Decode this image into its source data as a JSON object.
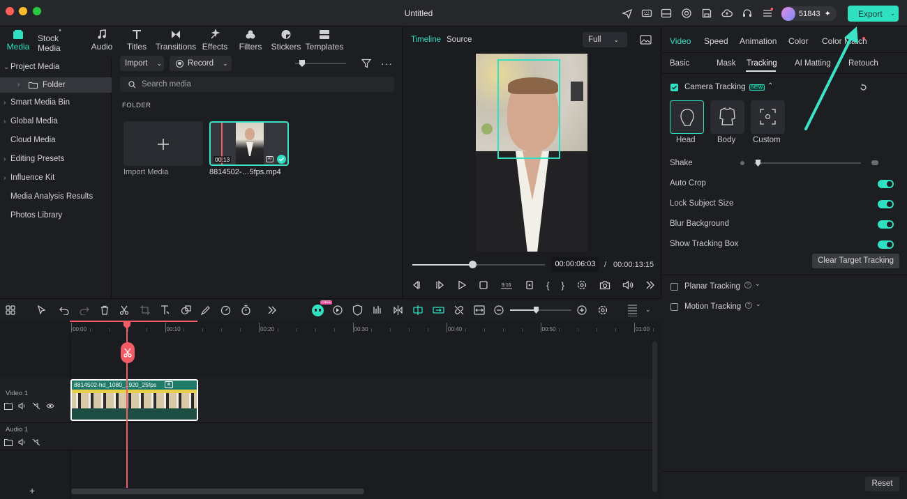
{
  "window": {
    "title": "Untitled",
    "credits": "51843",
    "export_label": "Export"
  },
  "library_tabs": [
    {
      "label": "Media",
      "icon": "media-icon",
      "active": true
    },
    {
      "label": "Stock Media",
      "icon": "stock-media-icon"
    },
    {
      "label": "Audio",
      "icon": "audio-icon"
    },
    {
      "label": "Titles",
      "icon": "titles-icon"
    },
    {
      "label": "Transitions",
      "icon": "transitions-icon"
    },
    {
      "label": "Effects",
      "icon": "effects-icon"
    },
    {
      "label": "Filters",
      "icon": "filters-icon"
    },
    {
      "label": "Stickers",
      "icon": "stickers-icon"
    },
    {
      "label": "Templates",
      "icon": "templates-icon"
    }
  ],
  "sidebar": {
    "items": [
      {
        "label": "Project Media",
        "chevron": "v"
      },
      {
        "label": "Folder",
        "chevron": ">",
        "selected": true
      },
      {
        "label": "Smart Media Bin",
        "chevron": ">"
      },
      {
        "label": "Global Media",
        "chevron": ">"
      },
      {
        "label": "Cloud Media",
        "chevron": ""
      },
      {
        "label": "Editing Presets",
        "chevron": ">"
      },
      {
        "label": "Influence Kit",
        "chevron": ">"
      },
      {
        "label": "Media Analysis Results",
        "chevron": ""
      },
      {
        "label": "Photos Library",
        "chevron": ""
      }
    ]
  },
  "media": {
    "import_label": "Import",
    "record_label": "Record",
    "search_placeholder": "Search media",
    "folder_header": "FOLDER",
    "import_tile_label": "Import Media",
    "clip_name": "8814502-…5fps.mp4",
    "clip_duration": "00:13"
  },
  "player": {
    "tab_timeline": "Timeline",
    "tab_source": "Source",
    "quality": "Full",
    "current_time": "00:00:06:03",
    "separator": "/",
    "total_time": "00:00:13:15",
    "progress": 0.45
  },
  "right_panel": {
    "tabs": [
      "Video",
      "Speed",
      "Animation",
      "Color",
      "Color Match"
    ],
    "active_tab": "Video",
    "subtabs": [
      "Basic",
      "Mask",
      "Tracking",
      "AI Matting",
      "Retouch"
    ],
    "active_subtab": "Tracking",
    "camera_tracking_label": "Camera Tracking",
    "new_badge": "NEW",
    "modes": [
      {
        "label": "Head",
        "icon": "head-icon"
      },
      {
        "label": "Body",
        "icon": "body-icon"
      },
      {
        "label": "Custom",
        "icon": "custom-frame-icon"
      }
    ],
    "options": [
      {
        "label": "Shake",
        "type": "slider",
        "value": 0.0
      },
      {
        "label": "Auto Crop",
        "type": "toggle",
        "on": true
      },
      {
        "label": "Lock Subject Size",
        "type": "toggle",
        "on": true
      },
      {
        "label": "Blur Background",
        "type": "toggle",
        "on": true
      },
      {
        "label": "Show Tracking Box",
        "type": "toggle",
        "on": true
      }
    ],
    "clear_button": "Clear Target Tracking",
    "planar_tracking": "Planar Tracking",
    "motion_tracking": "Motion Tracking",
    "reset_label": "Reset"
  },
  "timeline": {
    "ticks": [
      "00:00",
      "00:10",
      "00:20",
      "00:30",
      "00:40",
      "00:50",
      "01:00"
    ],
    "video_track_label": "Video 1",
    "audio_track_label": "Audio 1",
    "clip_label": "8814502-hd_1080_1920_25fps",
    "ai_badge": "FREE"
  },
  "colors": {
    "accent": "#2fe0c1",
    "playhead": "#f25c67",
    "bg": "#1b1c20"
  }
}
